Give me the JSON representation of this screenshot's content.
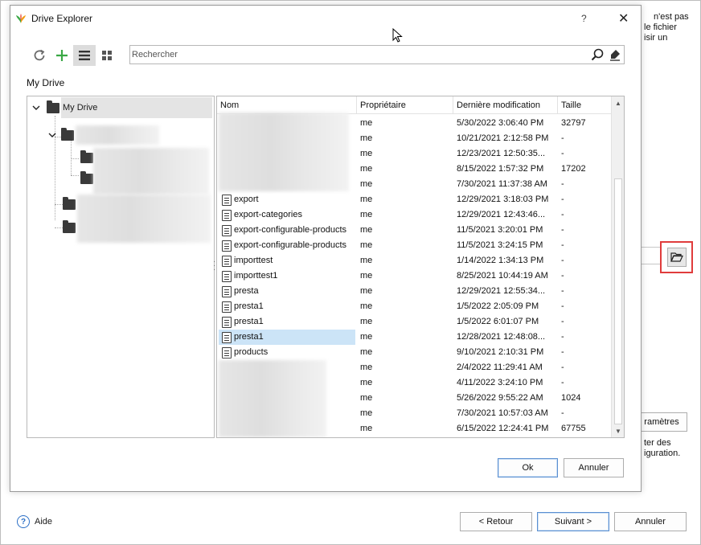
{
  "background": {
    "text_top": [
      "n'est pas",
      "le fichier",
      "isir un"
    ],
    "params_button": "ramètres",
    "text_mid": [
      "ter des",
      "iguration."
    ],
    "help_label": "Aide",
    "back_button": "< Retour",
    "next_button": "Suivant >",
    "cancel_button": "Annuler"
  },
  "dialog": {
    "title": "Drive Explorer",
    "help_glyph": "?",
    "close_glyph": "✕",
    "search_placeholder": "Rechercher",
    "path": "My Drive",
    "tree": {
      "root": "My Drive"
    },
    "columns": [
      "Nom",
      "Propriétaire",
      "Dernière modification",
      "Taille"
    ],
    "files": [
      {
        "name": "",
        "owner": "me",
        "modified": "5/30/2022 3:06:40 PM",
        "size": "32797"
      },
      {
        "name": "",
        "owner": "me",
        "modified": "10/21/2021 2:12:58 PM",
        "size": "-"
      },
      {
        "name": "",
        "owner": "me",
        "modified": "12/23/2021 12:50:35...",
        "size": "-"
      },
      {
        "name": "",
        "owner": "me",
        "modified": "8/15/2022 1:57:32 PM",
        "size": "17202"
      },
      {
        "name": "",
        "owner": "me",
        "modified": "7/30/2021 11:37:38 AM",
        "size": "-"
      },
      {
        "name": "export",
        "owner": "me",
        "modified": "12/29/2021 3:18:03 PM",
        "size": "-"
      },
      {
        "name": "export-categories",
        "owner": "me",
        "modified": "12/29/2021 12:43:46...",
        "size": "-"
      },
      {
        "name": "export-configurable-products",
        "owner": "me",
        "modified": "11/5/2021 3:20:01 PM",
        "size": "-"
      },
      {
        "name": "export-configurable-products",
        "owner": "me",
        "modified": "11/5/2021 3:24:15 PM",
        "size": "-"
      },
      {
        "name": "importtest",
        "owner": "me",
        "modified": "1/14/2022 1:34:13 PM",
        "size": "-"
      },
      {
        "name": "importtest1",
        "owner": "me",
        "modified": "8/25/2021 10:44:19 AM",
        "size": "-"
      },
      {
        "name": "presta",
        "owner": "me",
        "modified": "12/29/2021 12:55:34...",
        "size": "-"
      },
      {
        "name": "presta1",
        "owner": "me",
        "modified": "1/5/2022 2:05:09 PM",
        "size": "-"
      },
      {
        "name": "presta1",
        "owner": "me",
        "modified": "1/5/2022 6:01:07 PM",
        "size": "-"
      },
      {
        "name": "presta1",
        "owner": "me",
        "modified": "12/28/2021 12:48:08...",
        "size": "-"
      },
      {
        "name": "products",
        "owner": "me",
        "modified": "9/10/2021 2:10:31 PM",
        "size": "-"
      },
      {
        "name": "",
        "owner": "me",
        "modified": "2/4/2022 11:29:41 AM",
        "size": "-"
      },
      {
        "name": "",
        "owner": "me",
        "modified": "4/11/2022 3:24:10 PM",
        "size": "-"
      },
      {
        "name": "",
        "owner": "me",
        "modified": "5/26/2022 9:55:22 AM",
        "size": "1024"
      },
      {
        "name": "",
        "owner": "me",
        "modified": "7/30/2021 10:57:03 AM",
        "size": "-"
      },
      {
        "name": "",
        "owner": "me",
        "modified": "6/15/2022 12:24:41 PM",
        "size": "67755"
      }
    ],
    "selected_index": 14,
    "ok_button": "Ok",
    "cancel_button": "Annuler"
  },
  "colors": {
    "highlight_box": "#e03c3c",
    "selection": "#cce4f7",
    "add_icon": "#3aa845",
    "accent": "#2b6fc6"
  }
}
